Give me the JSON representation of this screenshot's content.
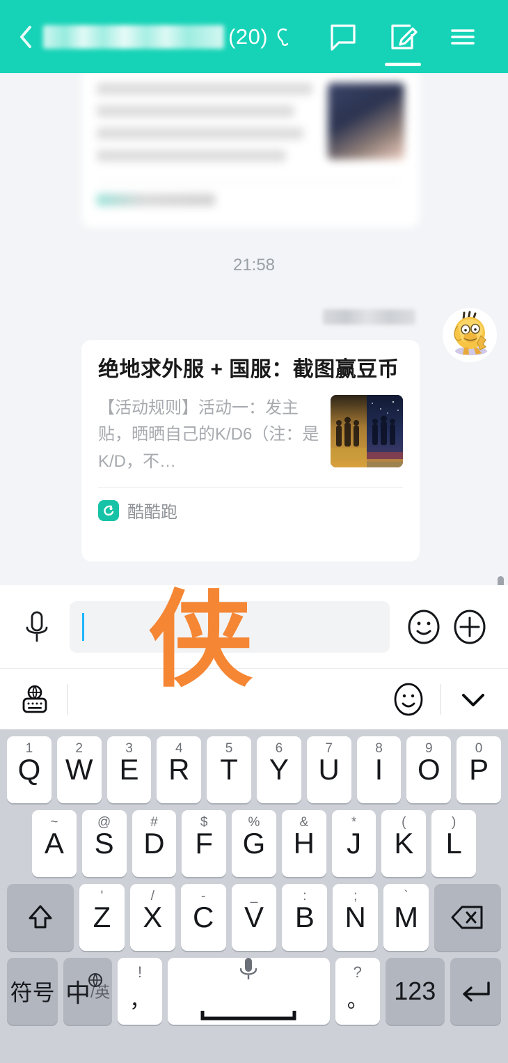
{
  "header": {
    "back_icon": "back-arrow-icon",
    "title_redacted": "",
    "member_count": "(20)",
    "ear_icon": "ear-listen-icon",
    "icons": [
      {
        "name": "chat-bubble-icon",
        "active": false
      },
      {
        "name": "compose-icon",
        "active": true
      },
      {
        "name": "menu-icon",
        "active": false
      }
    ],
    "accent_color": "#16d3b7"
  },
  "chat": {
    "timestamp": "21:58",
    "top_card_blurred": true,
    "avatar_icon": "psyduck-avatar",
    "sender_name_redacted": "",
    "link_card": {
      "title": "绝地求外服 + 国服：截图赢豆币",
      "description": "【活动规则】活动一：发主贴，晒晒自己的K/D6（注：是K/D，不…",
      "thumbnail_icon": "game-poster-thumbnail",
      "source_name": "酷酷跑",
      "source_icon": "kukupao-app-icon"
    }
  },
  "input_bar": {
    "mic_icon": "microphone-icon",
    "input_value": "",
    "input_placeholder": "",
    "emoji_icon": "emoji-smiley-icon",
    "plus_icon": "plus-circle-icon"
  },
  "watermark": {
    "text": "侠",
    "color": "#f58634"
  },
  "keyboard_toolbar": {
    "language_icon": "globe-keyboard-icon",
    "emoji_icon": "emoji-smiley-icon",
    "collapse_icon": "chevron-down-icon"
  },
  "keyboard": {
    "row1": [
      {
        "letter": "Q",
        "sup": "1"
      },
      {
        "letter": "W",
        "sup": "2"
      },
      {
        "letter": "E",
        "sup": "3"
      },
      {
        "letter": "R",
        "sup": "4"
      },
      {
        "letter": "T",
        "sup": "5"
      },
      {
        "letter": "Y",
        "sup": "6"
      },
      {
        "letter": "U",
        "sup": "7"
      },
      {
        "letter": "I",
        "sup": "8"
      },
      {
        "letter": "O",
        "sup": "9"
      },
      {
        "letter": "P",
        "sup": "0"
      }
    ],
    "row2": [
      {
        "letter": "A",
        "sup": "~"
      },
      {
        "letter": "S",
        "sup": "@"
      },
      {
        "letter": "D",
        "sup": "#"
      },
      {
        "letter": "F",
        "sup": "$"
      },
      {
        "letter": "G",
        "sup": "%"
      },
      {
        "letter": "H",
        "sup": "&"
      },
      {
        "letter": "J",
        "sup": "*"
      },
      {
        "letter": "K",
        "sup": "("
      },
      {
        "letter": "L",
        "sup": ")"
      }
    ],
    "row3": {
      "shift_icon": "shift-up-arrow-icon",
      "letters": [
        {
          "letter": "Z",
          "sup": "'"
        },
        {
          "letter": "X",
          "sup": "/"
        },
        {
          "letter": "C",
          "sup": "-"
        },
        {
          "letter": "V",
          "sup": "_"
        },
        {
          "letter": "B",
          "sup": ":"
        },
        {
          "letter": "N",
          "sup": ";"
        },
        {
          "letter": "M",
          "sup": "`"
        }
      ],
      "backspace_icon": "backspace-icon"
    },
    "row4": {
      "symbol_key": "符号",
      "lang_main": "中",
      "lang_sub": "/英",
      "lang_globe_icon": "globe-icon",
      "comma_top": "!",
      "comma_bottom": "，",
      "space_icon": "microphone-icon",
      "period_top": "?",
      "period_bottom": "。",
      "numeric_key": "123",
      "enter_icon": "enter-return-icon"
    }
  }
}
